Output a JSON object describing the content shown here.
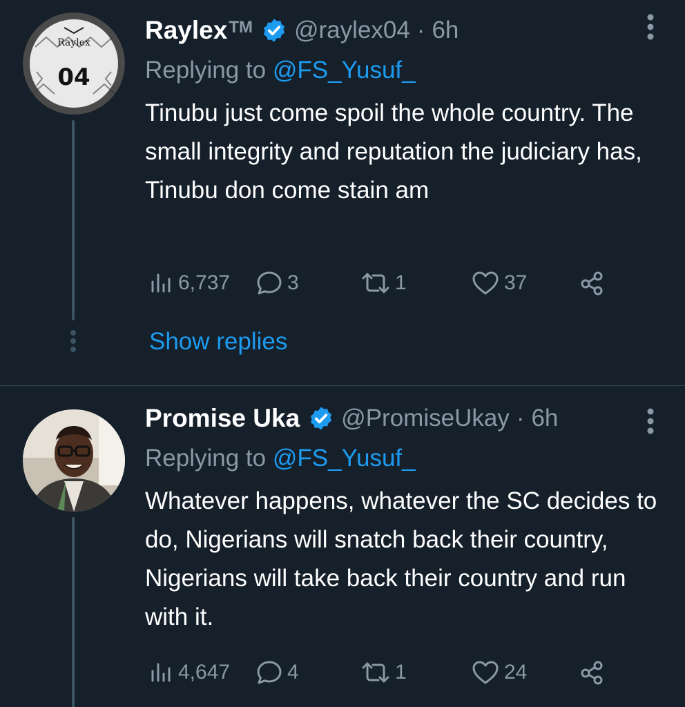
{
  "tweets": [
    {
      "author_name": "Raylex",
      "author_suffix": "TM",
      "handle": "@raylex04",
      "separator": "·",
      "time": "6h",
      "replying_prefix": "Replying to",
      "replying_to": "@FS_Yusuf_",
      "text": "Tinubu just come spoil the whole country. The small integrity and reputation the judiciary has, Tinubu don come stain am",
      "views": "6,737",
      "replies": "3",
      "retweets": "1",
      "likes": "37",
      "show_replies_label": "Show replies",
      "avatar_jersey_text": "Raylex",
      "avatar_jersey_number": "04"
    },
    {
      "author_name": "Promise Uka",
      "handle": "@PromiseUkay",
      "separator": "·",
      "time": "6h",
      "replying_prefix": "Replying to",
      "replying_to": "@FS_Yusuf_",
      "text": "Whatever happens, whatever the SC decides to do, Nigerians will snatch back their country, Nigerians will take back their country and run with it.",
      "views": "4,647",
      "replies": "4",
      "retweets": "1",
      "likes": "24"
    }
  ],
  "colors": {
    "background": "#15202b",
    "accent": "#1d9bf0",
    "muted": "#8b98a5",
    "divider": "#38444d"
  },
  "icons": [
    "verified-badge-icon",
    "more-icon",
    "views-icon",
    "reply-icon",
    "retweet-icon",
    "like-icon",
    "share-icon"
  ]
}
